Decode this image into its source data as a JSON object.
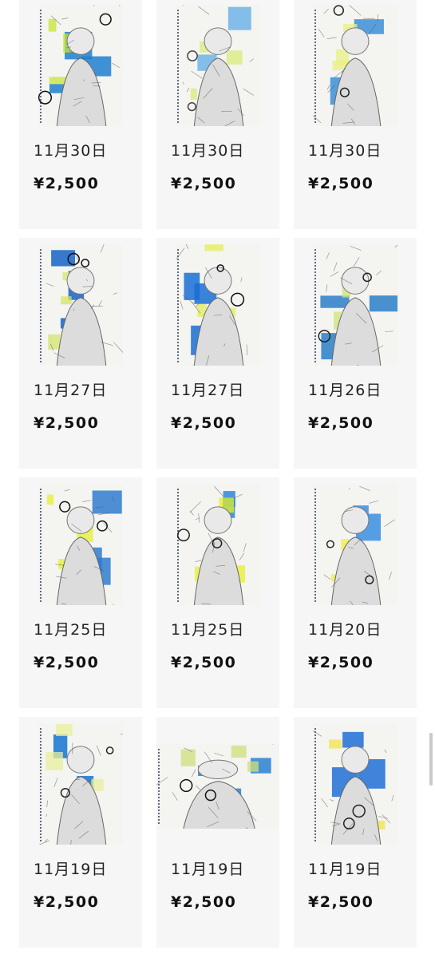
{
  "items": [
    {
      "date": "11月30日",
      "price": "¥2,500",
      "palette": [
        "#1e7fd0",
        "#c8e630",
        "#111111"
      ],
      "shape": "portrait"
    },
    {
      "date": "11月30日",
      "price": "¥2,500",
      "palette": [
        "#6fb4e8",
        "#d9ec7a",
        "#444444"
      ],
      "shape": "portrait"
    },
    {
      "date": "11月30日",
      "price": "¥2,500",
      "palette": [
        "#3b8fd8",
        "#e8f080",
        "#222222"
      ],
      "shape": "portrait"
    },
    {
      "date": "11月27日",
      "price": "¥2,500",
      "palette": [
        "#1463c9",
        "#d4e66a",
        "#111111"
      ],
      "shape": "portrait"
    },
    {
      "date": "11月27日",
      "price": "¥2,500",
      "palette": [
        "#1a6fd4",
        "#e4ee5a",
        "#111111"
      ],
      "shape": "portrait"
    },
    {
      "date": "11月26日",
      "price": "¥2,500",
      "palette": [
        "#2a7ec8",
        "#cfe474",
        "#222222"
      ],
      "shape": "portrait"
    },
    {
      "date": "11月25日",
      "price": "¥2,500",
      "palette": [
        "#2f7bd0",
        "#e6f030",
        "#111111"
      ],
      "shape": "portrait"
    },
    {
      "date": "11月25日",
      "price": "¥2,500",
      "palette": [
        "#2d86d8",
        "#e8f028",
        "#222222"
      ],
      "shape": "portrait"
    },
    {
      "date": "11月20日",
      "price": "¥2,500",
      "palette": [
        "#3a8ee0",
        "#eef040",
        "#222222"
      ],
      "shape": "portrait"
    },
    {
      "date": "11月19日",
      "price": "¥2,500",
      "palette": [
        "#1474d0",
        "#e9ef9a",
        "#222222"
      ],
      "shape": "portrait"
    },
    {
      "date": "11月19日",
      "price": "¥2,500",
      "palette": [
        "#2a80d2",
        "#cfe07a",
        "#111111"
      ],
      "shape": "landscape"
    },
    {
      "date": "11月19日",
      "price": "¥2,500",
      "palette": [
        "#1f6fd6",
        "#f0e64a",
        "#222222"
      ],
      "shape": "portrait"
    }
  ]
}
